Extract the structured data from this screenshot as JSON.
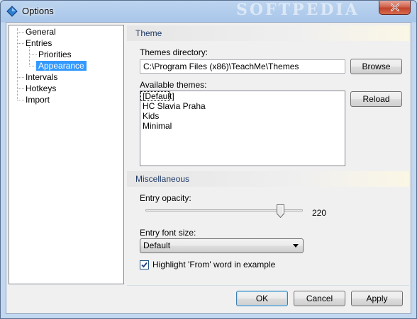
{
  "window": {
    "title": "Options",
    "watermark": "SOFTPEDIA",
    "close_icon": "close-icon"
  },
  "tree": {
    "items": [
      {
        "label": "General"
      },
      {
        "label": "Entries"
      },
      {
        "label": "Priorities"
      },
      {
        "label": "Appearance",
        "selected": true
      },
      {
        "label": "Intervals"
      },
      {
        "label": "Hotkeys"
      },
      {
        "label": "Import"
      }
    ]
  },
  "theme": {
    "header": "Theme",
    "directory_label": "Themes directory:",
    "directory_value": "C:\\Program Files (x86)\\TeachMe\\Themes",
    "browse_label": "Browse",
    "available_label": "Available themes:",
    "reload_label": "Reload",
    "themes": [
      "[Default]",
      "HC Slavia Praha",
      "Kids",
      "Minimal"
    ]
  },
  "misc": {
    "header": "Miscellaneous",
    "opacity_label": "Entry opacity:",
    "opacity_value": "220",
    "opacity_fraction": 0.86,
    "font_size_label": "Entry font size:",
    "font_size_selected": "Default",
    "highlight_label": "Highlight 'From' word in example",
    "highlight_checked": true
  },
  "footer": {
    "ok_label": "OK",
    "cancel_label": "Cancel",
    "apply_label": "Apply"
  },
  "colors": {
    "selection": "#3399ff",
    "section_text": "#1e3966"
  }
}
